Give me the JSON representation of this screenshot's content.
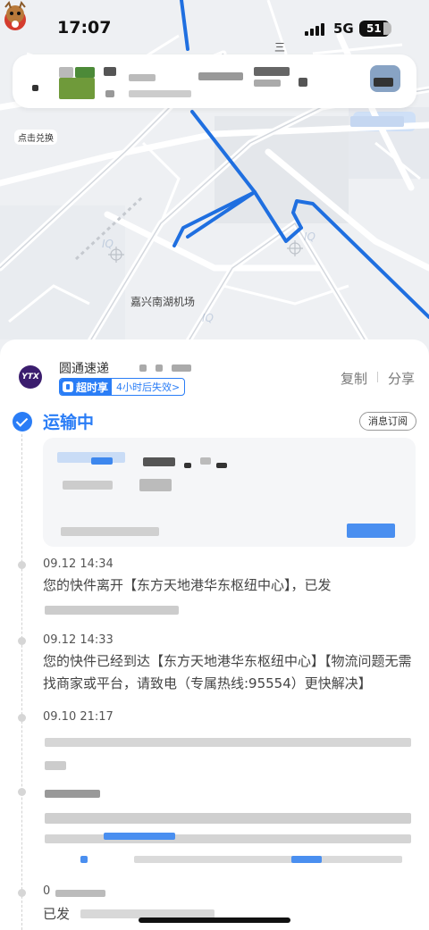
{
  "status_bar": {
    "time": "17:07",
    "network": "5G",
    "battery": "51"
  },
  "map": {
    "airport_label": "嘉兴南湖机场",
    "top_label": "三",
    "promo_label": "点击兑换"
  },
  "courier": {
    "logo_text": "YTX",
    "name": "圆通速递",
    "badge_label": "超时享",
    "badge_note": "4小时后失效>",
    "copy_label": "复制",
    "share_label": "分享"
  },
  "shipment": {
    "status": "运输中",
    "subscribe_label": "消息订阅"
  },
  "timeline": [
    {
      "time": "09.12 14:34",
      "text_a": "您的快件离开【东方天地港华东枢纽中心】，已发",
      "text_b": ""
    },
    {
      "time": "09.12 14:33",
      "text_a": "您的快件已经到达【东方天地港华东枢纽中心】【物流问题无需找商家或平台，请致电（专属热线:95554）更快解决】",
      "text_b": ""
    },
    {
      "time": "09.10 21:17",
      "text_a": "",
      "text_b": ""
    },
    {
      "time": "",
      "text_a": "",
      "text_b": ""
    },
    {
      "time": "0",
      "text_a": "已发",
      "text_b": ""
    }
  ],
  "colors": {
    "accent": "#2a7df6",
    "route": "#1f6fe0",
    "map_bg": "#eef0f3"
  },
  "icons": [
    "check-icon",
    "shield-icon",
    "mascot-icon",
    "plane-icon"
  ]
}
